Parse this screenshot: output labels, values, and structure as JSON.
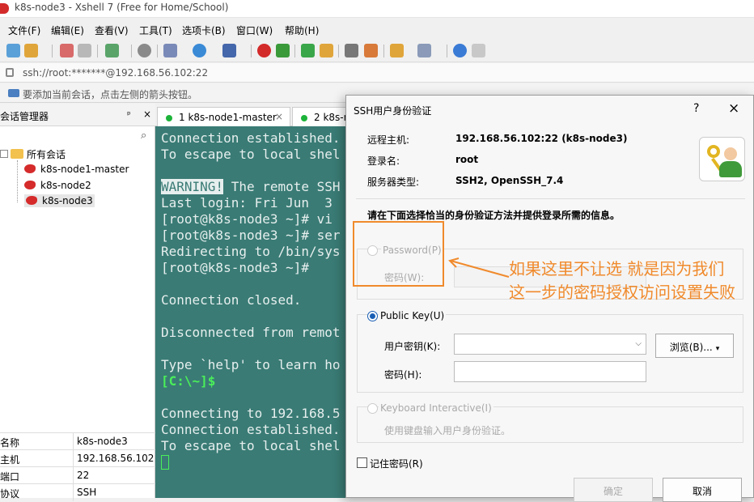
{
  "window": {
    "title": "k8s-node3 - Xshell 7 (Free for Home/School)"
  },
  "menu": [
    "文件(F)",
    "编辑(E)",
    "查看(V)",
    "工具(T)",
    "选项卡(B)",
    "窗口(W)",
    "帮助(H)"
  ],
  "address_bar": {
    "url": "ssh://root:*******@192.168.56.102:22"
  },
  "hint_bar": {
    "text": "要添加当前会话，点击左侧的箭头按钮。"
  },
  "session_manager": {
    "title": "会话管理器",
    "pin_icon": "ᵖ",
    "close_icon": "×",
    "root": "所有会话",
    "sessions": [
      "k8s-node1-master",
      "k8s-node2",
      "k8s-node3"
    ],
    "selected": "k8s-node3",
    "properties": [
      {
        "key": "名称",
        "value": "k8s-node3"
      },
      {
        "key": "主机",
        "value": "192.168.56.102"
      },
      {
        "key": "端口",
        "value": "22"
      },
      {
        "key": "协议",
        "value": "SSH"
      }
    ]
  },
  "tabs": [
    {
      "label": "1 k8s-node1-master",
      "close": "×"
    },
    {
      "label": "2 k8s-no"
    }
  ],
  "terminal": {
    "lines": [
      "Connection established.",
      "To escape to local shel",
      "",
      "WARNING!| The remote SSH",
      "Last login: Fri Jun  3",
      "[root@k8s-node3 ~]# vi",
      "[root@k8s-node3 ~]# ser",
      "Redirecting to /bin/sys",
      "[root@k8s-node3 ~]#",
      "",
      "Connection closed.",
      "",
      "Disconnected from remot",
      "",
      "Type `help' to learn ho",
      "[C:\\~]$",
      "",
      "Connecting to 192.168.5",
      "Connection established.",
      "To escape to local shel"
    ]
  },
  "dialog": {
    "title": "SSH用户身份验证",
    "help": "?",
    "close": "×",
    "remote_host_label": "远程主机:",
    "remote_host_value": "192.168.56.102:22 (k8s-node3)",
    "login_label": "登录名:",
    "login_value": "root",
    "server_type_label": "服务器类型:",
    "server_type_value": "SSH2, OpenSSH_7.4",
    "instruction": "请在下面选择恰当的身份验证方法并提供登录所需的信息。",
    "password_option": "Password(P)",
    "password_field_label": "密码(W):",
    "pubkey_option": "Public Key(U)",
    "user_key_label": "用户密钥(K):",
    "browse_button": "浏览(B)...",
    "passphrase_label": "密码(H):",
    "keyboard_option": "Keyboard Interactive(I)",
    "keyboard_desc": "使用键盘输入用户身份验证。",
    "remember_label": "记住密码(R)",
    "ok_button": "确定",
    "cancel_button": "取消"
  },
  "annotation": {
    "line1": "如果这里不让选 就是因为我们",
    "line2": "这一步的密码授权访问设置失败",
    "color": "#f08a2c"
  }
}
